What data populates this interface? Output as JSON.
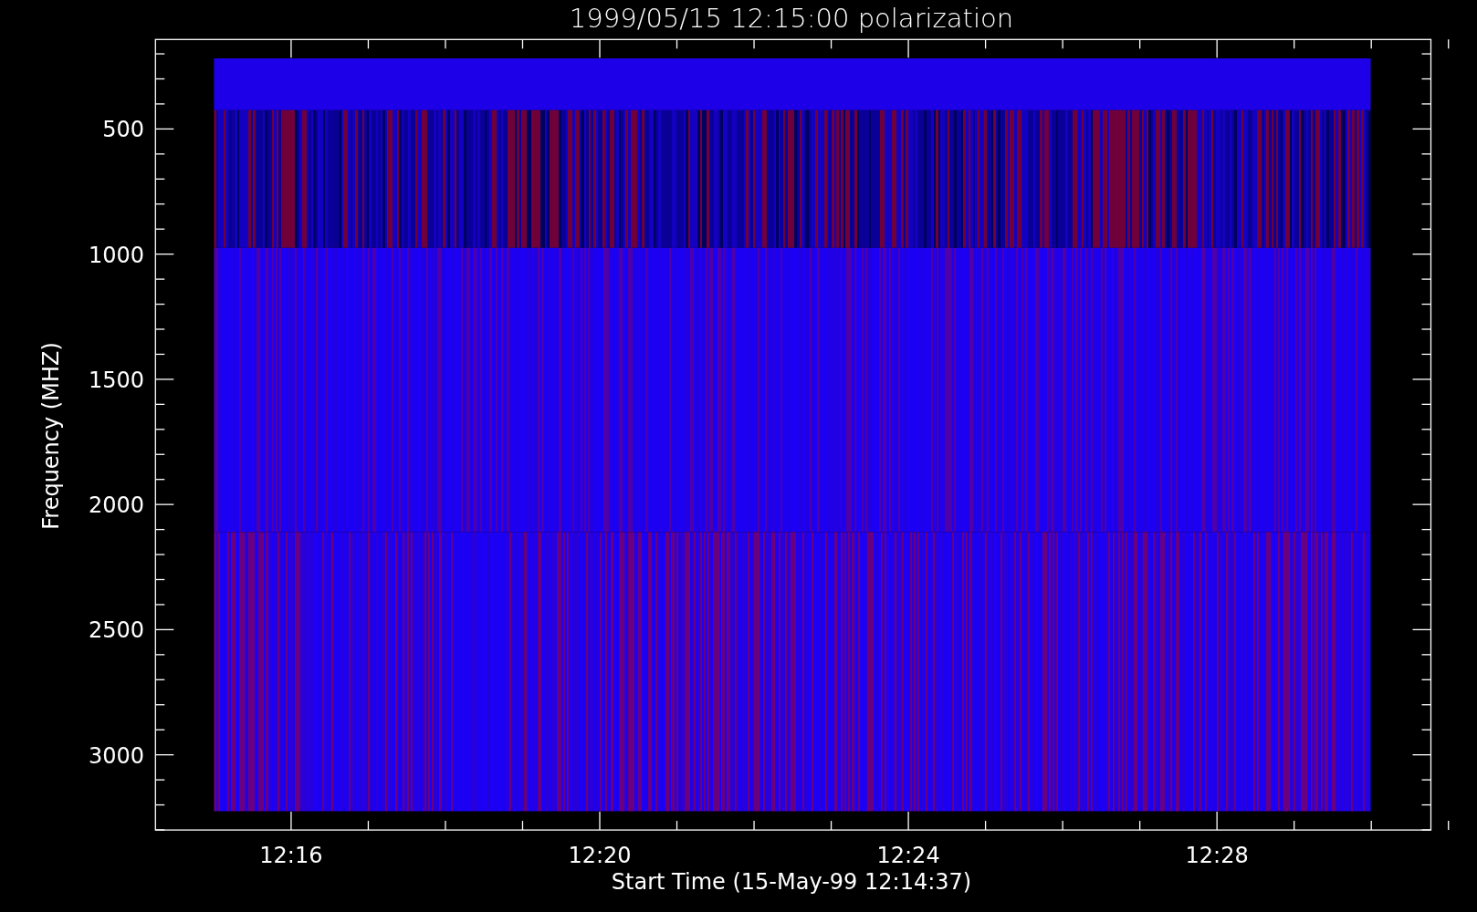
{
  "title": "1999/05/15 12:15:00 polarization",
  "x_axis": {
    "label": "Start Time (15-May-99 12:14:37)",
    "ticks": [
      "12:16",
      "12:20",
      "12:24",
      "12:28"
    ]
  },
  "y_axis": {
    "label": "Frequency (MHZ)",
    "ticks": [
      "500",
      "1000",
      "1500",
      "2000",
      "2500",
      "3000"
    ]
  }
}
